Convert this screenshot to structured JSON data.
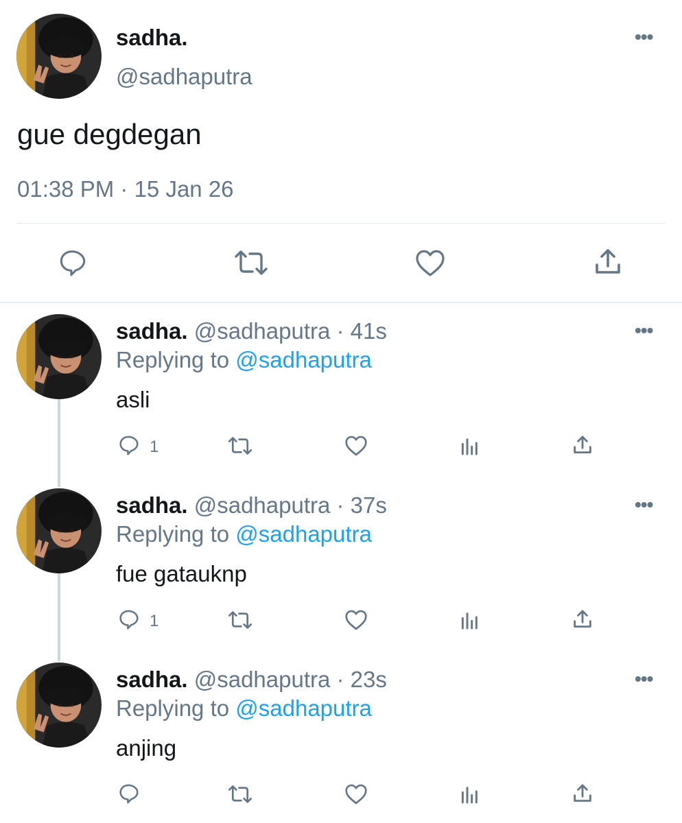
{
  "main_tweet": {
    "display_name": "sadha.",
    "handle": "@sadhaputra",
    "text": "gue degdegan",
    "timestamp": "01:38 PM · 15 Jan 26",
    "more_icon": "•••",
    "actions": [
      "reply-icon",
      "retweet-icon",
      "like-icon",
      "share-icon"
    ]
  },
  "replies": [
    {
      "display_name": "sadha.",
      "meta": "@sadhaputra · 41s",
      "replying_prefix": "Replying to ",
      "replying_to": "@sadhaputra",
      "text": "asli",
      "reply_count": "1",
      "more_icon": "•••"
    },
    {
      "display_name": "sadha.",
      "meta": "@sadhaputra · 37s",
      "replying_prefix": "Replying to ",
      "replying_to": "@sadhaputra",
      "text": "fue gatauknp",
      "reply_count": "1",
      "more_icon": "•••"
    },
    {
      "display_name": "sadha.",
      "meta": "@sadhaputra · 23s",
      "replying_prefix": "Replying to ",
      "replying_to": "@sadhaputra",
      "text": "anjing",
      "reply_count": "",
      "more_icon": "•••"
    }
  ],
  "colors": {
    "text": "#14171a",
    "secondary": "#657786",
    "link": "#1da1f2",
    "divider": "#e1e8ed",
    "thread_line": "#ccd6dd"
  }
}
